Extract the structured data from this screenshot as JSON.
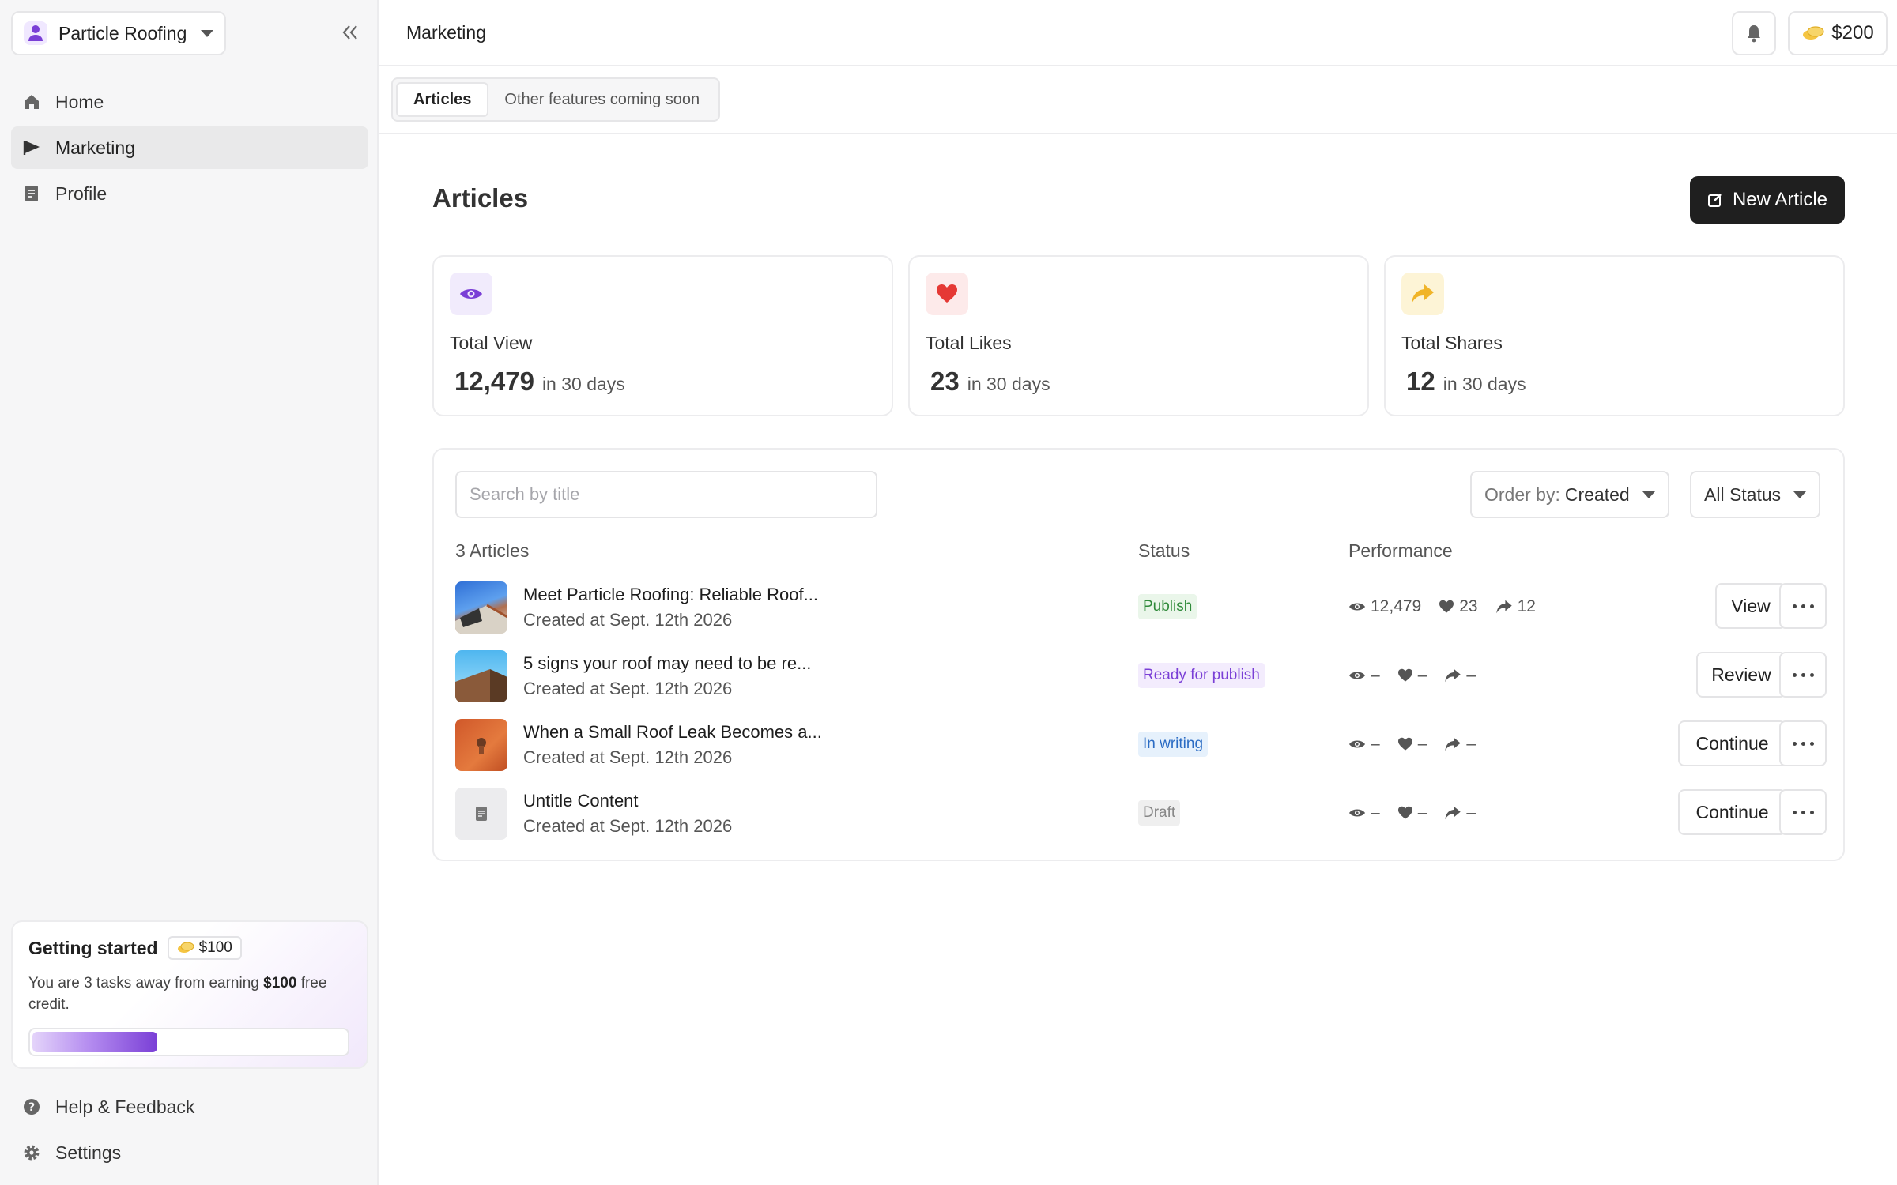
{
  "sidebar": {
    "workspace": "Particle Roofing",
    "items": [
      {
        "label": "Home",
        "icon": "home-icon"
      },
      {
        "label": "Marketing",
        "icon": "megaphone-icon"
      },
      {
        "label": "Profile",
        "icon": "document-icon"
      }
    ],
    "getting_started": {
      "title": "Getting started",
      "badge": "$100",
      "text_pre": "You are 3 tasks away from earning ",
      "text_bold": "$100",
      "text_post": " free credit.",
      "progress": 0.4
    },
    "bottom": [
      {
        "label": "Help & Feedback",
        "icon": "help-icon"
      },
      {
        "label": "Settings",
        "icon": "gear-icon"
      }
    ]
  },
  "header": {
    "page": "Marketing",
    "credit": "$200"
  },
  "tabs": [
    {
      "label": "Articles",
      "active": true
    },
    {
      "label": "Other features coming soon",
      "active": false
    }
  ],
  "main": {
    "title": "Articles",
    "new_button": "New Article",
    "stats": [
      {
        "label": "Total View",
        "value": "12,479",
        "suffix": "in 30 days",
        "icon": "eye-icon"
      },
      {
        "label": "Total Likes",
        "value": "23",
        "suffix": "in 30 days",
        "icon": "heart-icon"
      },
      {
        "label": "Total Shares",
        "value": "12",
        "suffix": "in 30 days",
        "icon": "share-icon"
      }
    ],
    "search_placeholder": "Search by title",
    "order_label": "Order by:",
    "order_value": "Created",
    "status_filter": "All Status",
    "columns": {
      "count": "3 Articles",
      "status": "Status",
      "performance": "Performance"
    },
    "articles": [
      {
        "title": "Meet Particle Roofing: Reliable Roof...",
        "created": "Created at Sept. 12th 2026",
        "status": "Publish",
        "views": "12,479",
        "likes": "23",
        "shares": "12",
        "action": "View"
      },
      {
        "title": "5 signs your roof may need to be re...",
        "created": "Created at Sept. 12th 2026",
        "status": "Ready for publish",
        "views": "–",
        "likes": "–",
        "shares": "–",
        "action": "Review"
      },
      {
        "title": "When a Small Roof Leak Becomes a...",
        "created": "Created at Sept. 12th 2026",
        "status": "In writing",
        "views": "–",
        "likes": "–",
        "shares": "–",
        "action": "Continue"
      },
      {
        "title": "Untitle Content",
        "created": "Created at Sept. 12th 2026",
        "status": "Draft",
        "views": "–",
        "likes": "–",
        "shares": "–",
        "action": "Continue"
      }
    ]
  },
  "colors": {
    "accent": "#7a3fd6",
    "publish_bg": "#eaf6ea",
    "publish_fg": "#2f8a3a",
    "ready_bg": "#f3ecfd",
    "ready_fg": "#7a3fd6",
    "writing_bg": "#e6f1fc",
    "writing_fg": "#2b6cc4",
    "draft_bg": "#efefef",
    "draft_fg": "#888888"
  }
}
